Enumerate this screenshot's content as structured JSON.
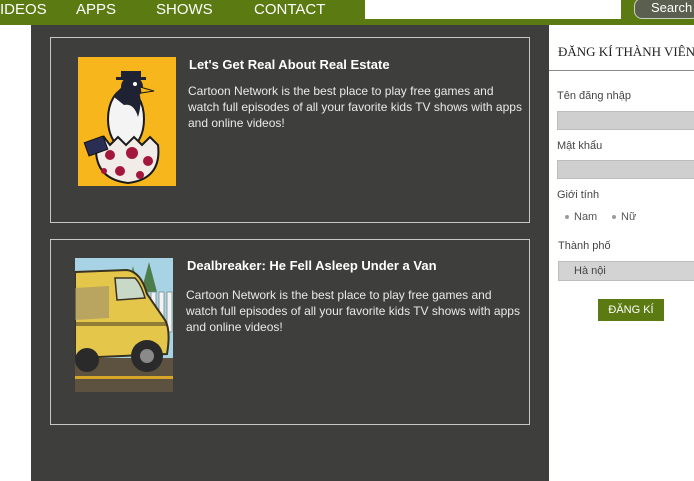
{
  "nav": {
    "items": [
      {
        "label": "VIDEOS"
      },
      {
        "label": "APPS"
      },
      {
        "label": "SHOWS"
      },
      {
        "label": "CONTACT"
      }
    ],
    "search_button": "Search"
  },
  "posts": [
    {
      "title": "Let's Get Real About Real Estate",
      "description": "Cartoon Network is the best place to play free games and watch full episodes of all your favorite kids TV shows with apps and online videos!"
    },
    {
      "title": "Dealbreaker: He Fell Asleep Under a Van",
      "description": "Cartoon Network is the best place to play free games and watch full episodes of all your favorite kids TV shows with apps and online videos!"
    }
  ],
  "register": {
    "title": "ĐĂNG KÍ THÀNH VIÊN",
    "username_label": "Tên đăng nhập",
    "password_label": "Mật khẩu",
    "gender_label": "Giới tính",
    "gender_options": [
      "Nam",
      "Nữ"
    ],
    "city_label": "Thành phố",
    "city_selected": "Hà nội",
    "submit_label": "ĐĂNG KÍ"
  },
  "colors": {
    "brand_green": "#5b7a12",
    "content_bg": "#3e3f3d"
  }
}
